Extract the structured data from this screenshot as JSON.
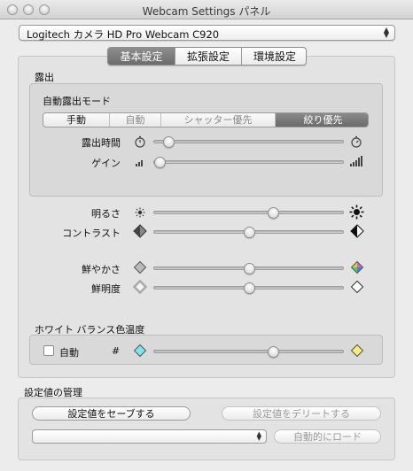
{
  "window": {
    "title": "Webcam Settings パネル"
  },
  "device": {
    "selected": "Logitech カメラ HD Pro Webcam C920"
  },
  "tabs": [
    {
      "label": "基本設定",
      "selected": true
    },
    {
      "label": "拡張設定",
      "selected": false
    },
    {
      "label": "環境設定",
      "selected": false
    }
  ],
  "exposure": {
    "section_label": "露出",
    "mode_label": "自動露出モード",
    "modes": [
      {
        "label": "手動",
        "enabled": true,
        "selected": false
      },
      {
        "label": "自動",
        "enabled": false,
        "selected": false
      },
      {
        "label": "シャッター優先",
        "enabled": false,
        "selected": false
      },
      {
        "label": "絞り優先",
        "enabled": true,
        "selected": true
      }
    ],
    "time_label": "露出時間",
    "time_value": 0.08,
    "gain_label": "ゲイン",
    "gain_value": 0.0
  },
  "adjust": {
    "brightness_label": "明るさ",
    "brightness_value": 0.63,
    "contrast_label": "コントラスト",
    "contrast_value": 0.5,
    "saturation_label": "鮮やかさ",
    "saturation_value": 0.5,
    "sharpness_label": "鮮明度",
    "sharpness_value": 0.5
  },
  "white_balance": {
    "section_label": "ホワイト バランス色温度",
    "auto_label": "自動",
    "auto_checked": false,
    "hash_label": "#",
    "value": 0.63
  },
  "management": {
    "section_label": "設定値の管理",
    "save_label": "設定値をセーブする",
    "delete_label": "設定値をデリートする",
    "preset_value": "",
    "autoload_label": "自動的にロード"
  },
  "colors": {
    "selected_tab": "#6f6f6f",
    "wb_cool": "#7ee3ee",
    "wb_warm": "#f5ec7a"
  }
}
